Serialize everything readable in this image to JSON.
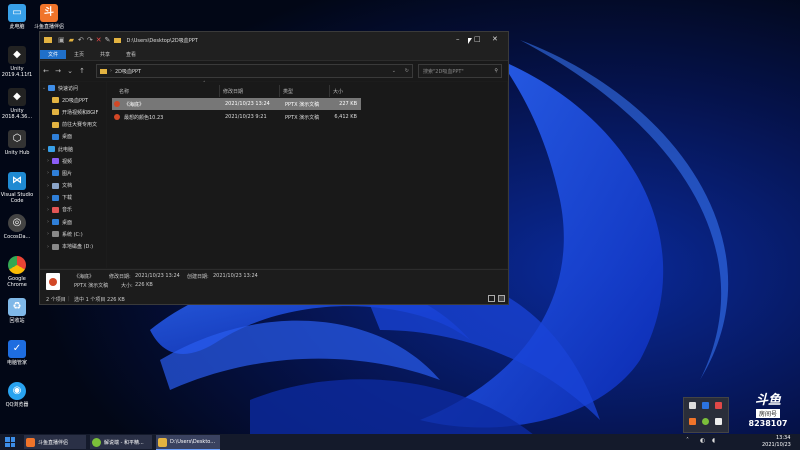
{
  "desktop_icons": [
    {
      "label": "此电脑",
      "icon": "computer-icon",
      "color": "#38a0e8"
    },
    {
      "label": "斗鱼直播伴侣",
      "icon": "douyu-app-icon",
      "color": "#f0742a"
    },
    {
      "label": "Unity 2019.4.11f1",
      "icon": "unity-icon",
      "color": "#222"
    },
    {
      "label": "Unity 2018.4.36...",
      "icon": "unity-icon",
      "color": "#222"
    },
    {
      "label": "Unity Hub",
      "icon": "unity-hub-icon",
      "color": "#333"
    },
    {
      "label": "Visual Studio Code",
      "icon": "vscode-icon",
      "color": "#1f8ad2"
    },
    {
      "label": "CocosDa...",
      "icon": "cocos-icon",
      "color": "#444"
    },
    {
      "label": "Google Chrome",
      "icon": "chrome-icon",
      "color": "#fbbc05"
    },
    {
      "label": "回收站",
      "icon": "recycle-bin-icon",
      "color": "#7fb8e8"
    },
    {
      "label": "电脑管家",
      "icon": "pc-manager-icon",
      "color": "#1e6de0"
    },
    {
      "label": "QQ浏览器",
      "icon": "qq-browser-icon",
      "color": "#29a3f0"
    }
  ],
  "explorer": {
    "title_path": "D:\\Users\\Desktop\\2D吸血PPT",
    "ribbon_tabs": [
      "文件",
      "主页",
      "共享",
      "查看"
    ],
    "address": "2D吸血PPT",
    "search_placeholder": "搜索\"2D吸血PPT\"",
    "columns": [
      "名称",
      "修改日期",
      "类型",
      "大小"
    ],
    "nav": [
      {
        "label": "快速访问",
        "color": "#3f8ee8",
        "expanded": true,
        "indent": 0
      },
      {
        "label": "2D吸血PPT",
        "color": "#e3b341",
        "indent": 1
      },
      {
        "label": "开场视频和8GIF",
        "color": "#e3b341",
        "indent": 1
      },
      {
        "label": "前往大赛专用文",
        "color": "#e3b341",
        "indent": 1
      },
      {
        "label": "桌面",
        "color": "#2f7fd8",
        "indent": 1
      },
      {
        "label": "此电脑",
        "color": "#38a0e8",
        "expanded": true,
        "indent": 0
      },
      {
        "label": "视频",
        "color": "#8b5cf6",
        "indent": 1
      },
      {
        "label": "图片",
        "color": "#2f7fd8",
        "indent": 1
      },
      {
        "label": "文档",
        "color": "#8aa4c8",
        "indent": 1
      },
      {
        "label": "下载",
        "color": "#2f7fd8",
        "indent": 1
      },
      {
        "label": "音乐",
        "color": "#e25555",
        "indent": 1
      },
      {
        "label": "桌面",
        "color": "#2f7fd8",
        "indent": 1
      },
      {
        "label": "系统 (C:)",
        "color": "#888",
        "indent": 1
      },
      {
        "label": "本地磁盘 (D:)",
        "color": "#888",
        "indent": 1
      }
    ],
    "files": [
      {
        "name": "《海底》",
        "modified": "2021/10/23 13:24",
        "type": "PPTX 演示文稿",
        "size": "227 KB",
        "selected": true
      },
      {
        "name": "最想的颜色10.23",
        "modified": "2021/10/23 9:21",
        "type": "PPTX 演示文稿",
        "size": "6,412 KB",
        "selected": false
      }
    ],
    "details": {
      "name": "《海底》",
      "modified_label": "修改日期:",
      "modified": "2021/10/23 13:24",
      "created_label": "创建日期:",
      "created": "2021/10/23 13:24",
      "type": "PPTX 演示文稿",
      "size_label": "大小:",
      "size": "226 KB"
    },
    "status": {
      "count": "2 个项目",
      "selection": "选中 1 个项目 226 KB"
    }
  },
  "taskbar": {
    "apps": [
      {
        "label": "斗鱼直播伴侣",
        "color": "#f0742a"
      },
      {
        "label": "解说端 - 和平精...",
        "color": "#7bbf3a"
      },
      {
        "label": "D:\\Users\\Deskto...",
        "color": "#e3b341"
      }
    ],
    "time": "13:34",
    "date": "2021/10/23"
  },
  "overlay": {
    "brand": "斗鱼",
    "room_label": "房间号",
    "room_number": "8238107"
  }
}
